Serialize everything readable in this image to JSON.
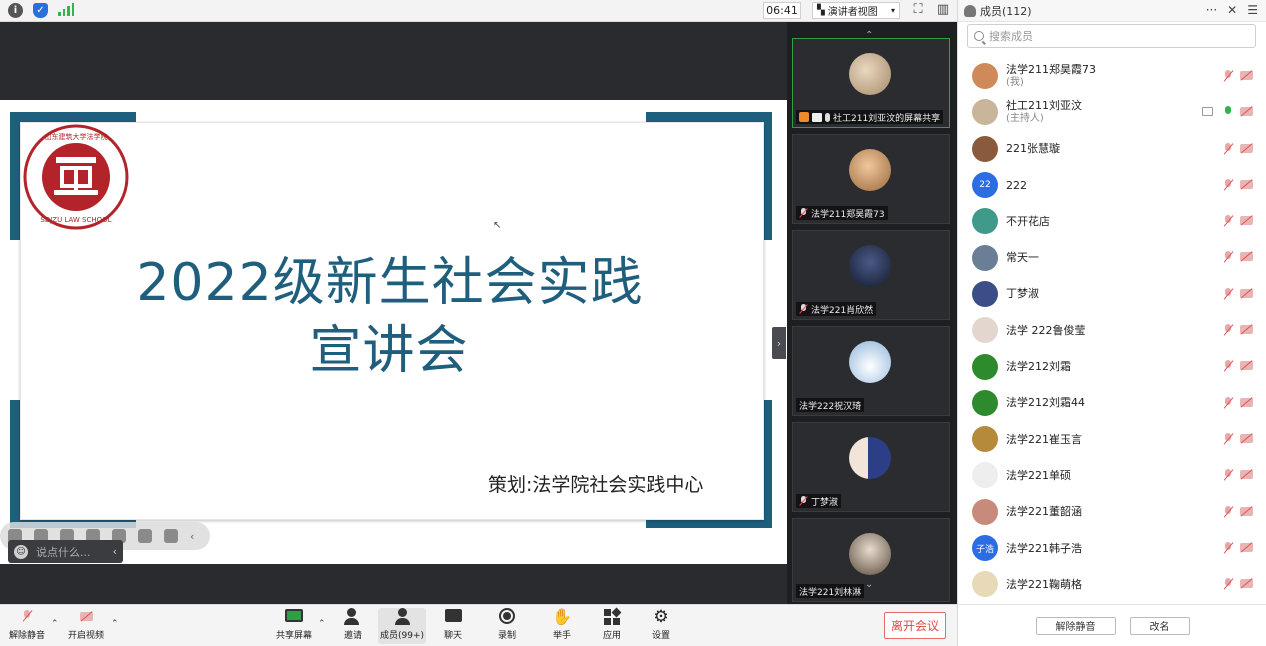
{
  "topbar": {
    "clock": "06:41",
    "view_mode": "演讲者视图",
    "icons": [
      "info-icon",
      "shield-icon",
      "signal-icon",
      "fullscreen-icon",
      "layout-icon",
      "more-icon"
    ]
  },
  "slide": {
    "title_line1": "2022级新生社会实践",
    "title_line2": "宣讲会",
    "footer": "策划:法学院社会实践中心",
    "logo_text": "山东建筑大学法学院",
    "logo_sub": "SDJZU LAW SCHOOL"
  },
  "chat_input": {
    "placeholder": "说点什么..."
  },
  "tiles": [
    {
      "name": "社工211刘亚汶的屏幕共享",
      "avatar_color": "#c9b69a",
      "active": true
    },
    {
      "name": "法学211郑昊霞73",
      "avatar_color": "#d89b62"
    },
    {
      "name": "法学221肖欣然",
      "avatar_color": "#2a3556"
    },
    {
      "name": "法学222祝汉琦",
      "avatar_color": "#a9c4e0"
    },
    {
      "name": "丁梦淑",
      "avatar_color": "#3b4f86"
    },
    {
      "name": "法学221刘林淋",
      "avatar_color": "#b9a79a"
    }
  ],
  "panel": {
    "title": "成员(112)",
    "search_placeholder": "搜索成员",
    "members": [
      {
        "name": "法学211郑昊霞73",
        "sub": "(我)",
        "color": "#d08a5a",
        "mic": "off"
      },
      {
        "name": "社工211刘亚汶",
        "sub": "(主持人)",
        "color": "#c9b69a",
        "mic": "on",
        "screen": true
      },
      {
        "name": "221张慧璇",
        "color": "#8a5a3c",
        "mic": "off"
      },
      {
        "name": "222",
        "badge": "22",
        "color": "#2d6de3",
        "mic": "off"
      },
      {
        "name": "不开花店",
        "color": "#3f9a8a",
        "mic": "off"
      },
      {
        "name": "常天一",
        "color": "#6a7f95",
        "mic": "off"
      },
      {
        "name": "丁梦淑",
        "color": "#3b4f86",
        "mic": "off"
      },
      {
        "name": "法学 222鲁俊莹",
        "color": "#e3d6cf",
        "mic": "off"
      },
      {
        "name": "法学212刘霜",
        "color": "#2d8a2d",
        "mic": "off"
      },
      {
        "name": "法学212刘霜44",
        "color": "#2d8a2d",
        "mic": "off"
      },
      {
        "name": "法学221崔玉言",
        "color": "#b58a3a",
        "mic": "off"
      },
      {
        "name": "法学221单硕",
        "color": "#eeeeee",
        "mic": "off"
      },
      {
        "name": "法学221董韶涵",
        "color": "#c88a7a",
        "mic": "off"
      },
      {
        "name": "法学221韩子浩",
        "badge": "子浩",
        "color": "#2d6de3",
        "mic": "off"
      },
      {
        "name": "法学221鞠萌格",
        "color": "#e8d9b8",
        "mic": "off"
      }
    ],
    "mute_all": "解除静音",
    "rename": "改名"
  },
  "toolbar": {
    "unmute": "解除静音",
    "start_video": "开启视频",
    "share_screen": "共享屏幕",
    "invite": "邀请",
    "members": "成员(99+)",
    "chat": "聊天",
    "record": "录制",
    "raise_hand": "举手",
    "apps": "应用",
    "settings": "设置",
    "leave": "离开会议"
  },
  "colors": {
    "brand_teal": "#1f5f7d",
    "danger": "#e04848",
    "active_green": "#2ea043"
  }
}
